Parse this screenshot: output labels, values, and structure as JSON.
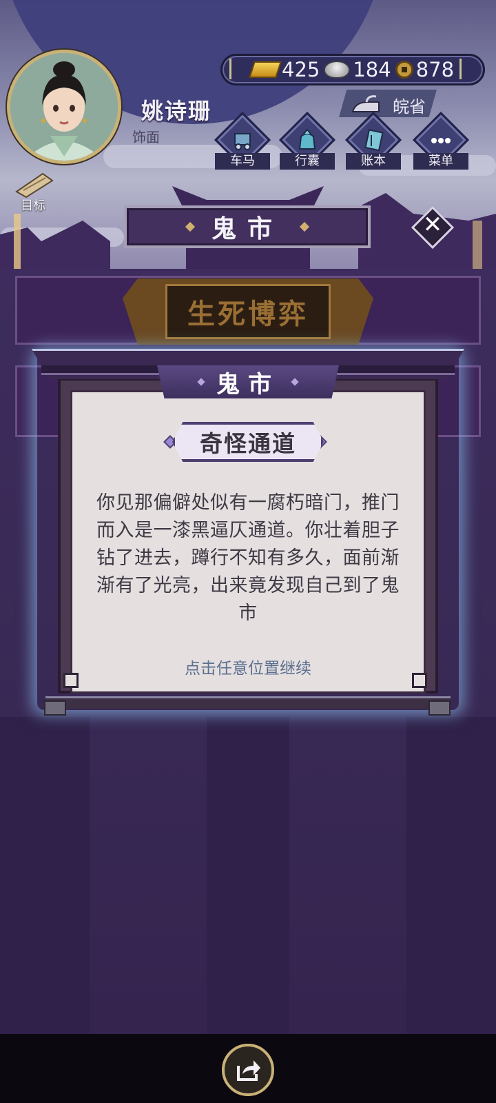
{
  "player": {
    "name": "姚诗珊",
    "title": "饰面"
  },
  "currency": {
    "gold": "425",
    "silver": "184",
    "copper": "878"
  },
  "region": {
    "label": "皖省"
  },
  "nav": {
    "items": [
      {
        "label": "车马",
        "icon": "carriage-icon"
      },
      {
        "label": "行囊",
        "icon": "bag-icon"
      },
      {
        "label": "账本",
        "icon": "ledger-icon"
      },
      {
        "label": "菜单",
        "icon": "menu-dots-icon"
      }
    ],
    "goal_label": "目标"
  },
  "location": {
    "name": "鬼市"
  },
  "game_banner": {
    "title": "生死博弈"
  },
  "dialog": {
    "tab_label": "鬼市",
    "event_title": "奇怪通道",
    "body": "你见那偏僻处似有一腐朽暗门，推门而入是一漆黑逼仄通道。你壮着胆子钻了进去，蹲行不知有多久，面前渐渐有了光亮，出来竟发现自己到了鬼市",
    "continue_hint": "点击任意位置继续"
  },
  "colors": {
    "accent_gold": "#c9b277",
    "panel_purple": "#3d2458",
    "hint_blue": "#5b6f8e"
  }
}
